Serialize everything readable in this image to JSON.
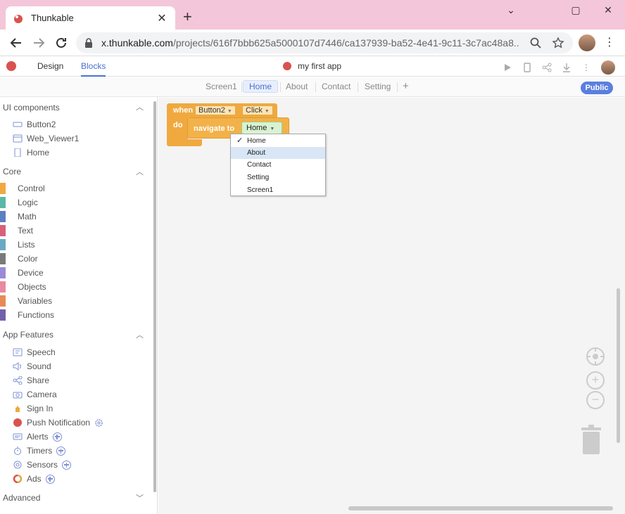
{
  "browser": {
    "tab_title": "Thunkable",
    "tab_close": "✕",
    "new_tab": "+",
    "url_host": "x.thunkable.com",
    "url_path": "/projects/616f7bbb625a5000107d7446/ca137939-ba52-4e41-9c11-3c7ac48a8...",
    "minimize": "⌄",
    "maximize": "▢",
    "close": "✕"
  },
  "app": {
    "tabs": [
      "Design",
      "Blocks"
    ],
    "active_tab": "Blocks",
    "project_name": "my first app",
    "publish_label": "Public",
    "screens": [
      "Screen1",
      "Home",
      "About",
      "Contact",
      "Setting"
    ],
    "active_screen": "Home",
    "add_screen": "+"
  },
  "sidebar": {
    "ui_components": {
      "title": "UI components",
      "items": [
        "Button2",
        "Web_Viewer1",
        "Home"
      ]
    },
    "core": {
      "title": "Core",
      "items": [
        {
          "label": "Control",
          "color": "#f0a93f"
        },
        {
          "label": "Logic",
          "color": "#5cb8a6"
        },
        {
          "label": "Math",
          "color": "#5b80c2"
        },
        {
          "label": "Text",
          "color": "#d9607a"
        },
        {
          "label": "Lists",
          "color": "#6aa9c4"
        },
        {
          "label": "Color",
          "color": "#7a7a7a"
        },
        {
          "label": "Device",
          "color": "#9b8ad6"
        },
        {
          "label": "Objects",
          "color": "#e88aa0"
        },
        {
          "label": "Variables",
          "color": "#e88a55"
        },
        {
          "label": "Functions",
          "color": "#7261a8"
        }
      ]
    },
    "app_features": {
      "title": "App Features",
      "items": [
        "Speech",
        "Sound",
        "Share",
        "Camera",
        "Sign In",
        "Push Notification",
        "Alerts",
        "Timers",
        "Sensors",
        "Ads"
      ]
    },
    "advanced": {
      "title": "Advanced"
    }
  },
  "blocks": {
    "when_label": "when",
    "component": "Button2",
    "event": "Click",
    "do_label": "do",
    "navigate_label": "navigate to",
    "target_screen": "Home"
  },
  "dropdown": {
    "selected": "Home",
    "highlighted": "About",
    "options": [
      "Home",
      "About",
      "Contact",
      "Setting",
      "Screen1"
    ]
  }
}
